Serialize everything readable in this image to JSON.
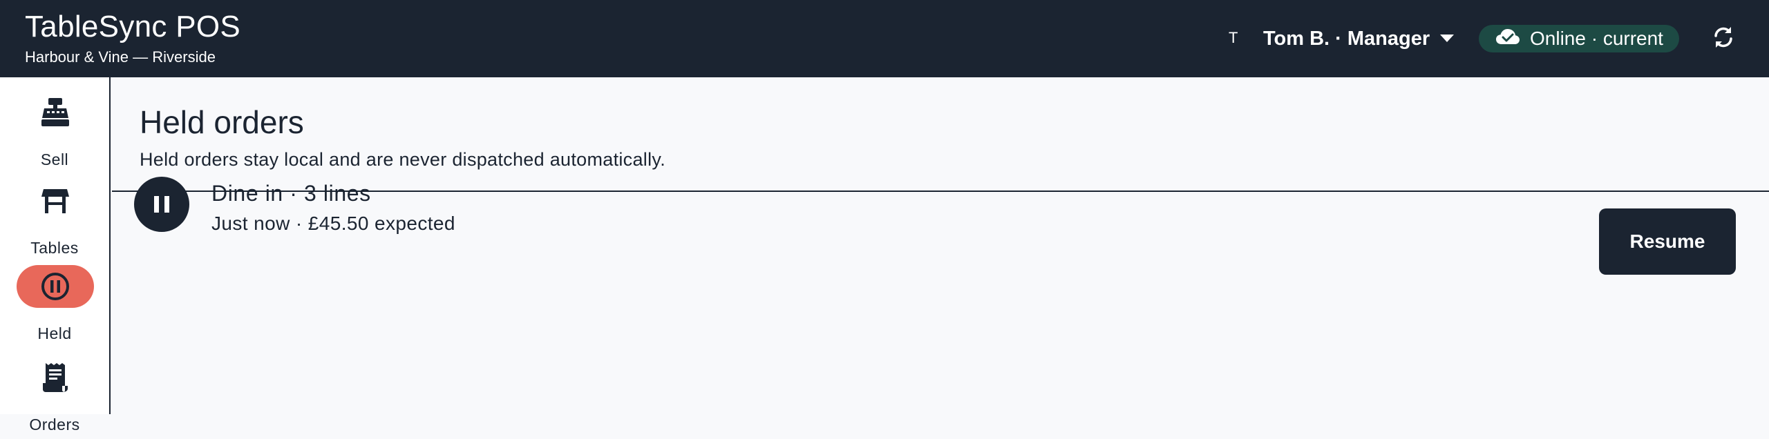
{
  "header": {
    "app_title": "TableSync POS",
    "location": "Harbour & Vine — Riverside",
    "user_initial": "T",
    "user_label": "Tom B. · Manager",
    "status_label": "Online · current",
    "status_color": "#1d4a44"
  },
  "sidebar": {
    "items": [
      {
        "label": "Sell",
        "icon": "cash-register-icon"
      },
      {
        "label": "Tables",
        "icon": "table-icon"
      },
      {
        "label": "Held",
        "icon": "pause-circle-icon",
        "active": true
      },
      {
        "label": "Orders",
        "icon": "receipt-icon"
      }
    ]
  },
  "main": {
    "title": "Held orders",
    "subtitle": "Held orders stay local and are never dispatched automatically.",
    "orders": [
      {
        "title": "Dine in · 3 lines",
        "meta": "Just now · £45.50 expected",
        "action_label": "Resume"
      }
    ]
  },
  "colors": {
    "header_bg": "#1b2431",
    "accent_active": "#e8685a",
    "online_status": "#1d4a44"
  }
}
